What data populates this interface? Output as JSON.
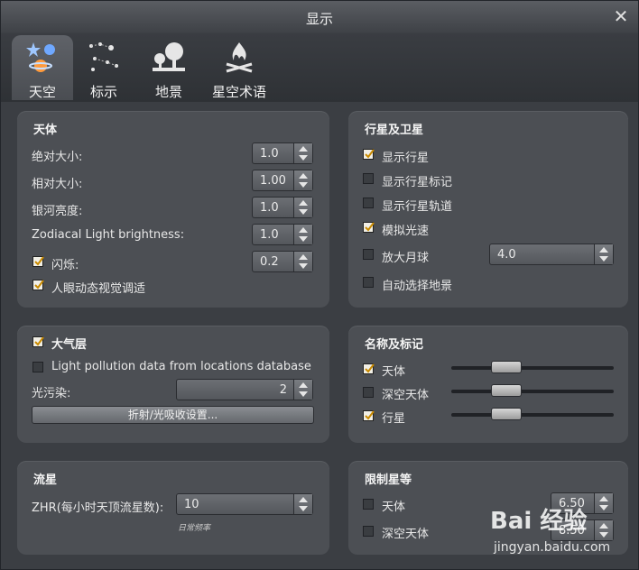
{
  "window": {
    "title": "显示"
  },
  "tabs": [
    {
      "label": "天空",
      "icon": "sky-icon",
      "active": true
    },
    {
      "label": "标示",
      "icon": "markings-icon"
    },
    {
      "label": "地景",
      "icon": "landscape-icon"
    },
    {
      "label": "星空术语",
      "icon": "starlore-icon"
    }
  ],
  "celestial": {
    "header": "天体",
    "abs_mag_label": "绝对大小:",
    "abs_mag_value": "1.0",
    "rel_mag_label": "相对大小:",
    "rel_mag_value": "1.00",
    "milky_label": "银河亮度:",
    "milky_value": "1.0",
    "zodiacal_label": "Zodiacal Light brightness:",
    "zodiacal_value": "1.0",
    "twinkle_label": "闪烁:",
    "twinkle_value": "0.2",
    "twinkle_checked": true,
    "adapt_label": "人眼动态视觉调适",
    "adapt_checked": true
  },
  "planets": {
    "header": "行星及卫星",
    "show_planets": "显示行星",
    "show_markers": "显示行星标记",
    "show_orbits": "显示行星轨道",
    "light_speed": "模拟光速",
    "moon_scale": "放大月球",
    "moon_scale_value": "4.0",
    "auto_landscape": "自动选择地景"
  },
  "atmosphere": {
    "header": "大气层",
    "lp_db_label": "Light pollution data from locations database",
    "lp_label": "光污染:",
    "lp_value": "2",
    "refraction_button": "折射/光吸收设置..."
  },
  "labels": {
    "header": "名称及标记",
    "stars": "天体",
    "dso": "深空天体",
    "planets": "行星"
  },
  "meteors": {
    "header": "流星",
    "zhr_label": "ZHR(每小时天顶流星数):",
    "zhr_value": "10",
    "zhr_note": "日常频率"
  },
  "limit_mag": {
    "header": "限制星等",
    "stars_label": "天体",
    "stars_value": "6.50",
    "dso_label": "深空天体",
    "dso_value": "8.50"
  },
  "watermark": {
    "brand": "Bai 经验",
    "url": "jingyan.baidu.com"
  }
}
